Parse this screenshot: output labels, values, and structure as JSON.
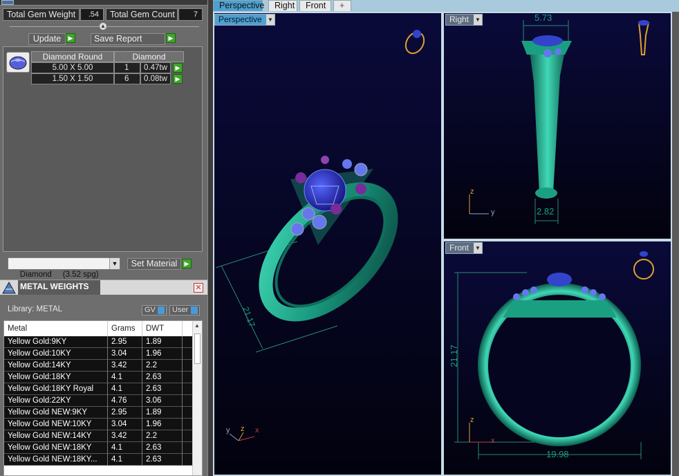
{
  "gem_summary": {
    "total_weight_label": "Total Gem Weight",
    "total_weight_value": ".54",
    "total_count_label": "Total Gem Count",
    "total_count_value": "7"
  },
  "buttons": {
    "update": "Update",
    "save_report": "Save Report",
    "set_material": "Set Material"
  },
  "gem_table": {
    "headers": [
      "Diamond Round",
      "Diamond"
    ],
    "rows": [
      {
        "size": "5.00 X 5.00",
        "count": "1",
        "weight": "0.47tw"
      },
      {
        "size": "1.50 X 1.50",
        "count": "6",
        "weight": "0.08tw"
      }
    ]
  },
  "material_select": {
    "value": "Diamond     (3.52 spg)"
  },
  "metal_weights": {
    "title": "METAL WEIGHTS",
    "library_label": "Library: METAL",
    "toggle_gv": "GV",
    "toggle_user": "User",
    "columns": [
      "Metal",
      "Grams",
      "DWT"
    ],
    "rows": [
      {
        "metal": "Yellow Gold:9KY",
        "grams": "2.95",
        "dwt": "1.89"
      },
      {
        "metal": "Yellow Gold:10KY",
        "grams": "3.04",
        "dwt": "1.96"
      },
      {
        "metal": "Yellow Gold:14KY",
        "grams": "3.42",
        "dwt": "2.2"
      },
      {
        "metal": "Yellow Gold:18KY",
        "grams": "4.1",
        "dwt": "2.63"
      },
      {
        "metal": "Yellow Gold:18KY Royal",
        "grams": "4.1",
        "dwt": "2.63"
      },
      {
        "metal": "Yellow Gold:22KY",
        "grams": "4.76",
        "dwt": "3.06"
      },
      {
        "metal": "Yellow Gold NEW:9KY",
        "grams": "2.95",
        "dwt": "1.89"
      },
      {
        "metal": "Yellow Gold NEW:10KY",
        "grams": "3.04",
        "dwt": "1.96"
      },
      {
        "metal": "Yellow Gold NEW:14KY",
        "grams": "3.42",
        "dwt": "2.2"
      },
      {
        "metal": "Yellow Gold NEW:18KY",
        "grams": "4.1",
        "dwt": "2.63"
      },
      {
        "metal": "Yellow Gold NEW:18KY...",
        "grams": "4.1",
        "dwt": "2.63"
      }
    ]
  },
  "view_tabs": [
    "Perspective",
    "Right",
    "Front",
    "+"
  ],
  "viewports": {
    "perspective": {
      "label": "Perspective",
      "dimension": "21.17",
      "axes": [
        "y",
        "z",
        "x"
      ]
    },
    "right": {
      "label": "Right",
      "dim_top": "5.73",
      "dim_bottom": "2.82",
      "axes": [
        "z",
        "y"
      ]
    },
    "front": {
      "label": "Front",
      "dim_height": "21.17",
      "dim_width": "19.98",
      "axes": [
        "z",
        "x"
      ]
    }
  },
  "icons": {
    "gem_thumb": "diamond-icon",
    "close": "close-icon",
    "metal": "metal-weights-icon",
    "collapse": "collapse-icon"
  },
  "colors": {
    "ring_metal": "#1fa58a",
    "gem_blue": "#2233cc",
    "accent_gold": "#e0a030",
    "active_tab": "#4fa0d0"
  }
}
